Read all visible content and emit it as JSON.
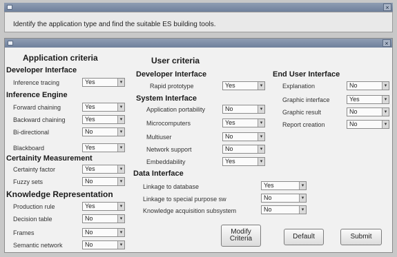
{
  "outer_window": {
    "title": "",
    "message": "Identify the application type and find the suitable ES building tools.",
    "close_glyph": "×"
  },
  "dialog": {
    "title": "",
    "close_glyph": "×"
  },
  "headers": {
    "application_criteria": "Application criteria",
    "user_criteria": "User criteria"
  },
  "sections": {
    "developer_interface_left": {
      "title": "Developer Interface",
      "items": [
        {
          "label": "Inference tracing",
          "value": "Yes"
        }
      ]
    },
    "inference_engine": {
      "title": "Inference Engine",
      "items": [
        {
          "label": "Forward chaining",
          "value": "Yes"
        },
        {
          "label": "Backward chaining",
          "value": "Yes"
        },
        {
          "label": "Bi-directional",
          "value": "No"
        },
        {
          "label": "Blackboard",
          "value": "Yes"
        }
      ]
    },
    "certainity_measurement": {
      "title": "Certainity Measurement",
      "items": [
        {
          "label": "Certainty factor",
          "value": "Yes"
        },
        {
          "label": "Fuzzy sets",
          "value": "No"
        }
      ]
    },
    "knowledge_representation": {
      "title": "Knowledge Representation",
      "items": [
        {
          "label": "Production rule",
          "value": "Yes"
        },
        {
          "label": "Decision table",
          "value": "No"
        },
        {
          "label": "Frames",
          "value": "No"
        },
        {
          "label": "Semantic network",
          "value": "No"
        }
      ]
    },
    "developer_interface_user": {
      "title": "Developer Interface",
      "items": [
        {
          "label": "Rapid prototype",
          "value": "Yes"
        }
      ]
    },
    "system_interface": {
      "title": "System Interface",
      "items": [
        {
          "label": "Application portability",
          "value": "No"
        },
        {
          "label": "Microcomputers",
          "value": "Yes"
        },
        {
          "label": "Multiuser",
          "value": "No"
        },
        {
          "label": "Network support",
          "value": "No"
        },
        {
          "label": "Embeddability",
          "value": "Yes"
        }
      ]
    },
    "end_user_interface": {
      "title": "End User Interface",
      "items": [
        {
          "label": "Explanation",
          "value": "No"
        },
        {
          "label": "Graphic interface",
          "value": "Yes"
        },
        {
          "label": "Graphic result",
          "value": "No"
        },
        {
          "label": "Report creation",
          "value": "No"
        }
      ]
    },
    "data_interface": {
      "title": "Data Interface",
      "items": [
        {
          "label": "Linkage to database",
          "value": "Yes"
        },
        {
          "label": "Linkage to special purpose sw",
          "value": "No"
        },
        {
          "label": "Knowledge acquisition subsystem",
          "value": "No"
        }
      ]
    }
  },
  "buttons": {
    "modify_line1": "Modify",
    "modify_line2": "Criteria",
    "default": "Default",
    "submit": "Submit"
  },
  "icons": {
    "dropdown_arrow": "▾"
  },
  "colors": {
    "titlebar": "#7f8fa8",
    "dialog_bg": "#f1f1f1"
  }
}
